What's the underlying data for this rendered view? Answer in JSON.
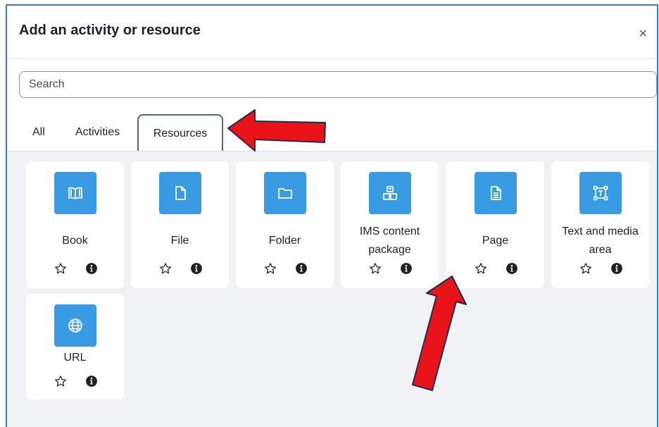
{
  "modal": {
    "title": "Add an activity or resource",
    "close_label": "×"
  },
  "search": {
    "placeholder": "Search"
  },
  "tabs": [
    {
      "label": "All"
    },
    {
      "label": "Activities"
    },
    {
      "label": "Resources",
      "active": true
    }
  ],
  "cards": [
    {
      "label": "Book",
      "icon": "book-icon"
    },
    {
      "label": "File",
      "icon": "file-icon"
    },
    {
      "label": "Folder",
      "icon": "folder-icon"
    },
    {
      "label": "IMS content package",
      "icon": "package-icon"
    },
    {
      "label": "Page",
      "icon": "page-icon"
    },
    {
      "label": "Text and media area",
      "icon": "text-media-icon"
    },
    {
      "label": "URL",
      "icon": "globe-icon"
    }
  ],
  "colors": {
    "icon_background": "#399be2",
    "annotation_arrow": "#e8141a",
    "frame_border": "#4472c4"
  }
}
